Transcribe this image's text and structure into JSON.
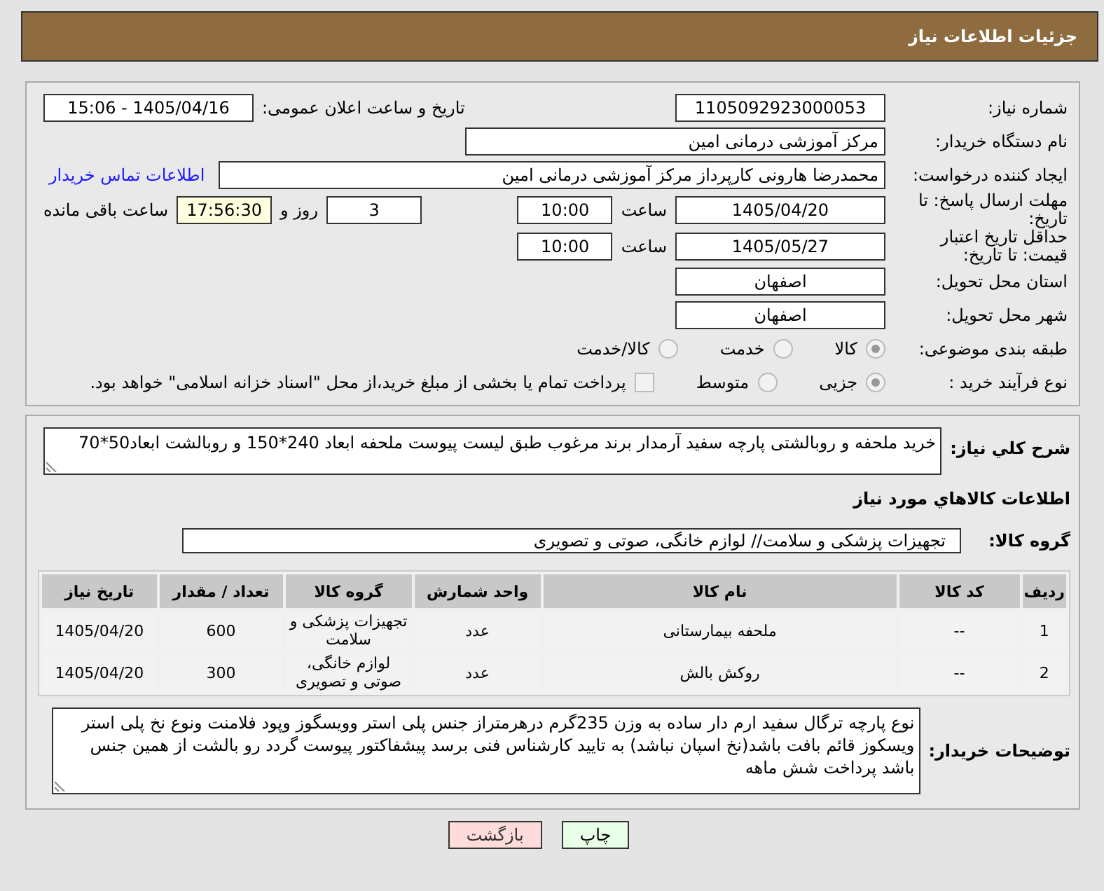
{
  "header": {
    "title": "جزئیات اطلاعات نیاز"
  },
  "rows": [
    {
      "label": "شماره نیاز:",
      "parts": [
        {
          "kind": "field",
          "value": "1105092923000053"
        },
        {
          "kind": "gap"
        },
        {
          "kind": "text",
          "text": "تاریخ و ساعت اعلان عمومی:"
        },
        {
          "kind": "field",
          "value": "1405/04/16 - 15:06"
        }
      ]
    },
    {
      "label": "نام دستگاه خریدار:",
      "parts": [
        {
          "kind": "wide_field",
          "value": "مرکز آموزشی درمانی امین"
        },
        {
          "kind": "gap"
        }
      ]
    },
    {
      "label": "ایجاد کننده درخواست:",
      "parts": [
        {
          "kind": "wide_field",
          "value": "محمدرضا هارونی کارپرداز مرکز آموزشی درمانی امین"
        },
        {
          "kind": "link",
          "text": "اطلاعات تماس خریدار"
        }
      ]
    },
    {
      "label": "مهلت ارسال پاسخ: تا تاریخ:",
      "parts": [
        {
          "kind": "field",
          "value": "1405/04/20"
        },
        {
          "kind": "text",
          "text": "ساعت"
        },
        {
          "kind": "small_field",
          "value": "10:00"
        },
        {
          "kind": "gap"
        },
        {
          "kind": "small_field",
          "value": "3"
        },
        {
          "kind": "text",
          "text": "روز و"
        },
        {
          "kind": "timer_field",
          "value": "17:56:30"
        },
        {
          "kind": "text",
          "text": "ساعت باقی مانده"
        }
      ]
    },
    {
      "label": "حداقل تاریخ اعتبار قیمت: تا تاریخ:",
      "parts": [
        {
          "kind": "field",
          "value": "1405/05/27"
        },
        {
          "kind": "text",
          "text": "ساعت"
        },
        {
          "kind": "small_field",
          "value": "10:00"
        }
      ]
    },
    {
      "label": "استان محل تحویل:",
      "parts": [
        {
          "kind": "field",
          "value": "اصفهان"
        }
      ]
    },
    {
      "label": "شهر محل تحویل:",
      "parts": [
        {
          "kind": "field",
          "value": "اصفهان"
        }
      ]
    },
    {
      "label": "طبقه بندی موضوعی:",
      "parts": [
        {
          "kind": "radio",
          "text": "کالا",
          "selected": true
        },
        {
          "kind": "radio",
          "text": "خدمت",
          "selected": false
        },
        {
          "kind": "radio",
          "text": "کالا/خدمت",
          "selected": false
        }
      ]
    },
    {
      "label": "نوع فرآیند خرید :",
      "parts": [
        {
          "kind": "radio",
          "text": "جزیی",
          "selected": true
        },
        {
          "kind": "radio",
          "text": "متوسط",
          "selected": false
        },
        {
          "kind": "checkbox",
          "text": "پرداخت تمام یا بخشی از مبلغ خرید،از محل \"اسناد خزانه اسلامی\" خواهد بود.",
          "checked": false
        }
      ]
    }
  ],
  "description": {
    "label": "شرح کلي نياز:",
    "value": "خرید ملحفه و روبالشتی پارچه سفید آرمدار برند مرغوب طبق لیست پیوست ملحفه ابعاد 240*150 و روبالشت ابعاد50*70"
  },
  "goods_heading": "اطلاعات کالاهاي مورد نياز",
  "goods_group": {
    "label": "گروه کالا:",
    "value": "تجهیزات پزشکی و سلامت// لوازم خانگی، صوتی و تصویری"
  },
  "table": {
    "columns": [
      "ردیف",
      "کد کالا",
      "نام کالا",
      "واحد شمارش",
      "گروه کالا",
      "تعداد / مقدار",
      "تاریخ نیاز"
    ],
    "rows": [
      [
        "1",
        "--",
        "ملحفه بیمارستانی",
        "عدد",
        "تجهیزات پزشکی و سلامت",
        "600",
        "1405/04/20"
      ],
      [
        "2",
        "--",
        "روکش بالش",
        "عدد",
        "لوازم خانگی، صوتی و تصویری",
        "300",
        "1405/04/20"
      ]
    ]
  },
  "buyer_notes": {
    "label": "توضیحات خریدار:",
    "value": "نوع پارچه ترگال سفید ارم دار ساده به وزن 235گرم درهرمتراز جنس پلی استر  وویسگوز وپود فلامنت ونوع نخ پلی استر ویسکوز قائم بافت باشد(نخ اسپان نباشد) به تایید کارشناس فنی برسد پیشفاکتور پیوست گردد رو بالشت از همین جنس باشد پرداخت شش ماهه"
  },
  "buttons": [
    {
      "label": "چاپ",
      "kind": "print"
    },
    {
      "label": "بازگشت",
      "kind": "back"
    }
  ]
}
